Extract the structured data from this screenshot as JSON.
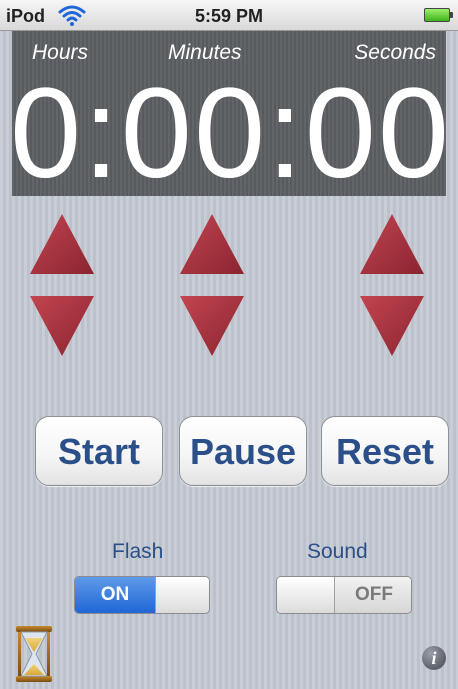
{
  "status_bar": {
    "carrier": "iPod",
    "time": "5:59 PM",
    "wifi_icon": "wifi-icon",
    "battery_icon": "battery-icon"
  },
  "display": {
    "hours_label": "Hours",
    "minutes_label": "Minutes",
    "seconds_label": "Seconds",
    "time": "0:00:00"
  },
  "arrows": {
    "icon_up": "triangle-up-icon",
    "icon_down": "triangle-down-icon",
    "color": "#a6333d"
  },
  "buttons": {
    "start": "Start",
    "pause": "Pause",
    "reset": "Reset"
  },
  "toggles": {
    "flash": {
      "label": "Flash",
      "state_text": "ON",
      "on": true
    },
    "sound": {
      "label": "Sound",
      "state_text": "OFF",
      "on": false
    }
  },
  "icons": {
    "hourglass": "hourglass-icon",
    "info": "info-icon"
  },
  "colors": {
    "accent_text": "#2a4f89",
    "switch_on": "#1f67d6",
    "display_bg": "#5f6268",
    "background": "#c5cad3"
  }
}
